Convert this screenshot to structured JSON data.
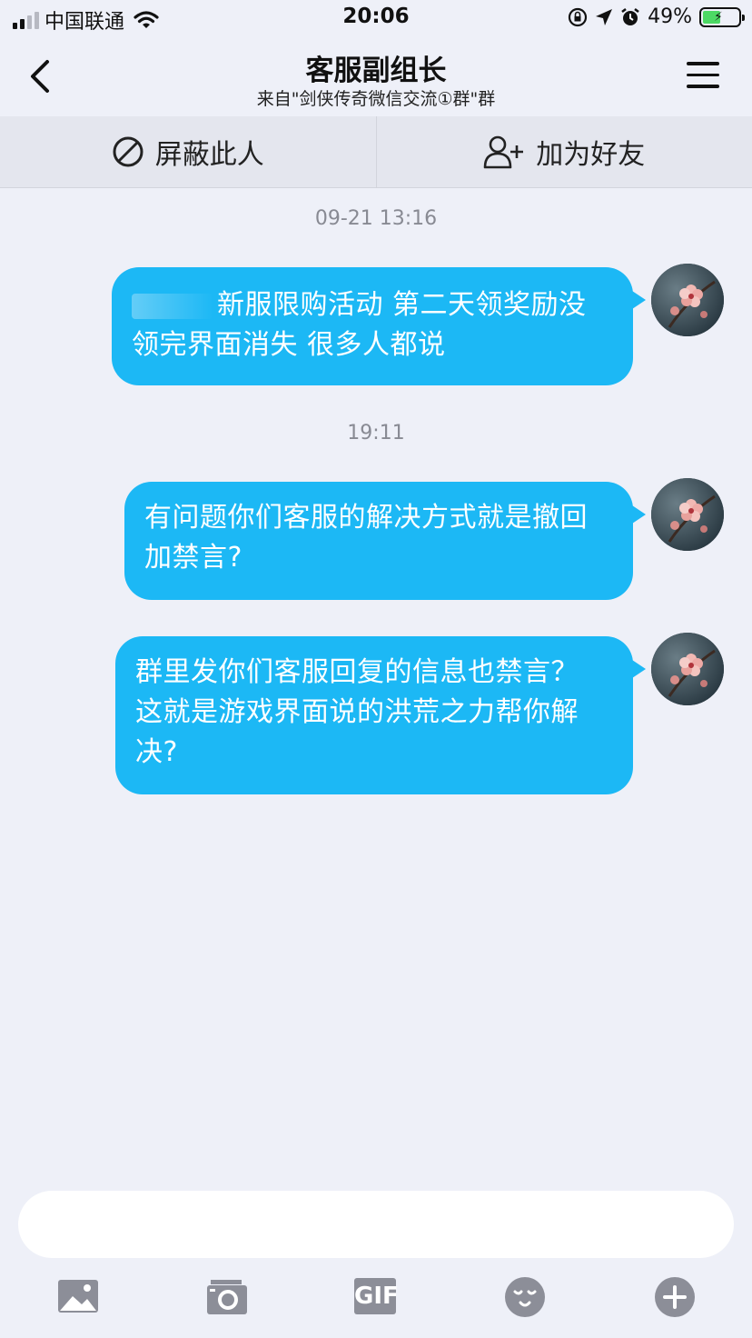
{
  "status_bar": {
    "carrier": "中国联通",
    "time": "20:06",
    "battery_percent": "49%",
    "battery_level": 0.49
  },
  "header": {
    "title": "客服副组长",
    "subtitle": "来自\"剑侠传奇微信交流①群\"群"
  },
  "actions": {
    "block_label": "屏蔽此人",
    "add_friend_label": "加为好友"
  },
  "messages": [
    {
      "time": "09-21 13:16",
      "text": "新服限购活动 第二天领奖励没领完界面消失 很多人都说"
    },
    {
      "time": "19:11",
      "text": "有问题你们客服的解决方式就是撤回加禁言?"
    },
    {
      "text": "群里发你们客服回复的信息也禁言？ 这就是游戏界面说的洪荒之力帮你解决?"
    }
  ],
  "toolbar": {
    "icons": [
      "image-icon",
      "camera-icon",
      "gif-icon",
      "emoji-icon",
      "plus-icon"
    ],
    "gif_label": "GIF"
  },
  "colors": {
    "bubble": "#1cb8f5",
    "background": "#eef0f8",
    "toolbar_icon": "#8c8e98"
  }
}
